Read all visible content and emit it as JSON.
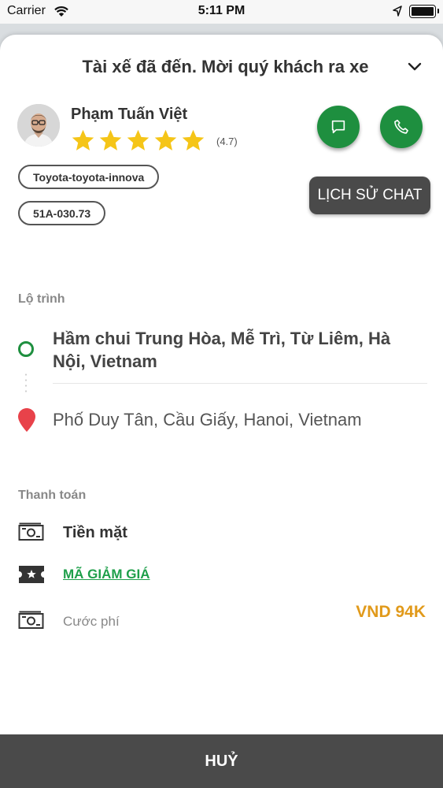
{
  "status": {
    "carrier": "Carrier",
    "time": "5:11 PM"
  },
  "header": {
    "title": "Tài xế đã đến. Mời quý khách ra xe"
  },
  "driver": {
    "name": "Phạm Tuấn Việt",
    "stars": 5,
    "rating_text": "(4.7)",
    "car_model": "Toyota-toyota-innova",
    "plate": "51A-030.73"
  },
  "actions": {
    "chat_history": "LỊCH SỬ CHAT"
  },
  "route": {
    "label": "Lộ trình",
    "origin": "Hầm chui Trung Hòa, Mễ Trì, Từ Liêm, Hà Nội, Vietnam",
    "destination": "Phố Duy Tân, Cầu Giấy, Hanoi, Vietnam"
  },
  "payment": {
    "label": "Thanh toán",
    "method": "Tiền mặt",
    "voucher": "MÃ GIẢM GIÁ",
    "fare_label": "Cước phí",
    "fare_value": "VND 94K"
  },
  "footer": {
    "cancel": "HUỶ"
  },
  "colors": {
    "primary_green": "#1e8f3f",
    "fare_orange": "#e19a1b",
    "star_yellow": "#f5c518",
    "pin_red": "#e8424a",
    "dark_bar": "#4a4a4a"
  }
}
